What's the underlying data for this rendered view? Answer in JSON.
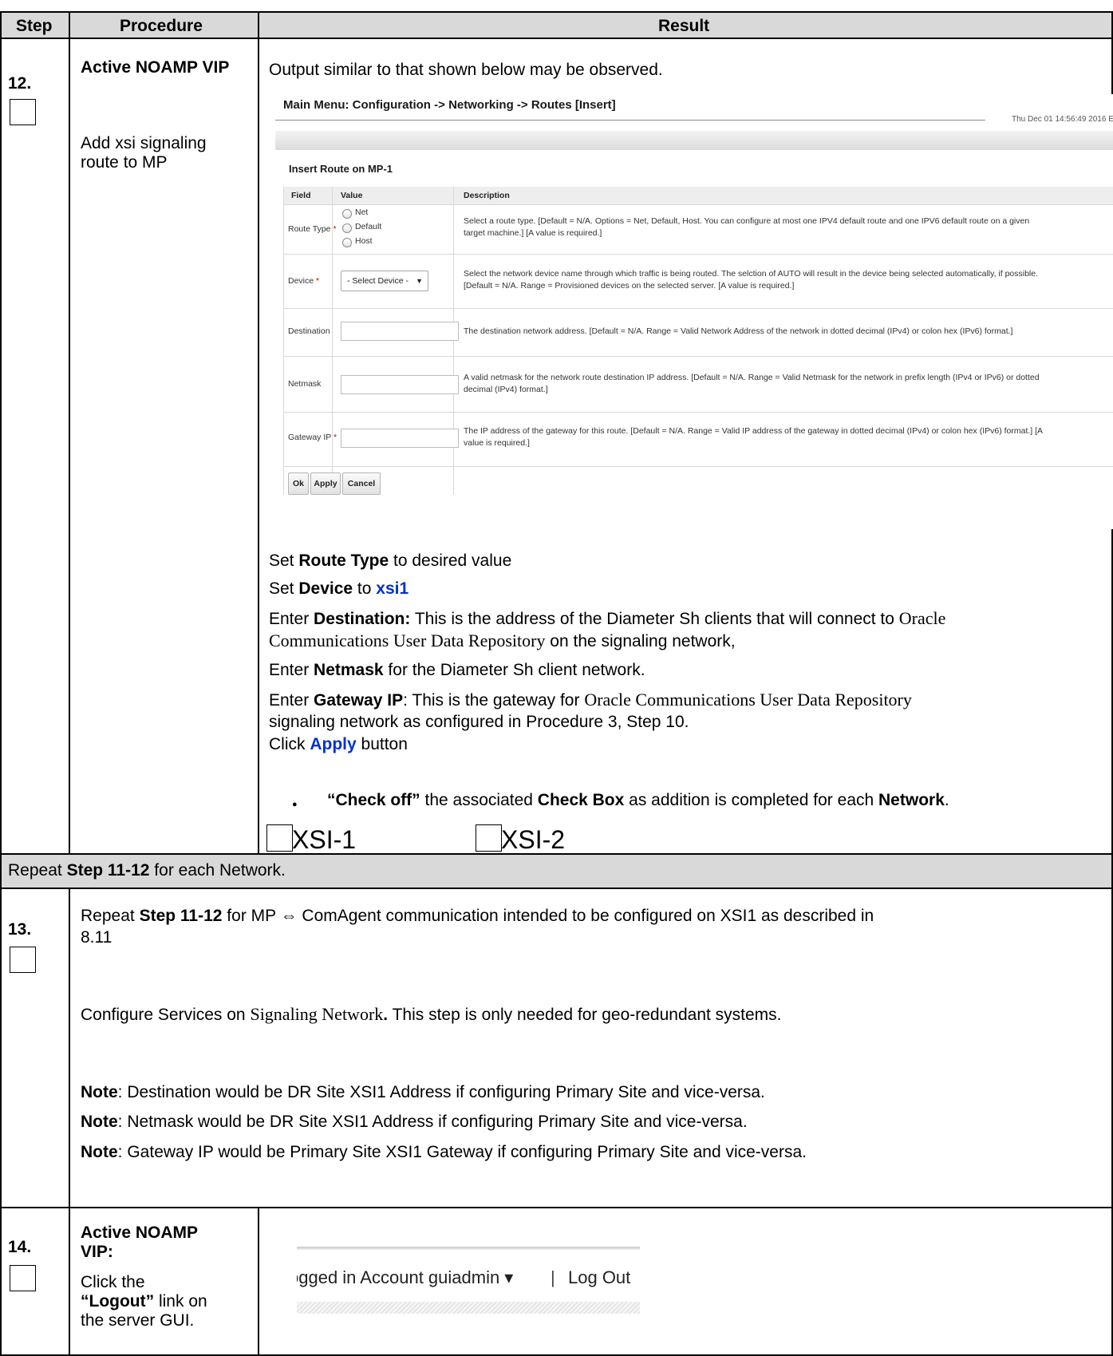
{
  "table_header": {
    "step": "Step",
    "procedure": "Procedure",
    "result": "Result"
  },
  "step12": {
    "number": "12.",
    "proc_title": "Active NOAMP VIP",
    "proc_desc": "Add xsi signaling route to MP",
    "intro": "Output similar to that shown below may be observed.",
    "screenshot": {
      "breadcrumb": "Main Menu: Configuration -> Networking -> Routes [Insert]",
      "timestamp": "Thu Dec 01 14:56:49 2016 E",
      "form_title": "Insert Route on MP-1",
      "columns": [
        "Field",
        "Value",
        "Description"
      ],
      "route_type_label": "Route Type",
      "route_type_options": [
        "Net",
        "Default",
        "Host"
      ],
      "route_type_desc_1": "Select a route type. [Default = N/A. Options = Net, Default, Host. You can configure at most one IPV4 default route and one IPV6 default route on a given",
      "route_type_desc_2": "target machine.] [A value is required.]",
      "device_label": "Device",
      "device_select": "- Select Device -",
      "device_desc_1": "Select the network device name through which traffic is being routed. The selction of AUTO will result in the device being selected automatically, if possible.",
      "device_desc_2": "[Default = N/A. Range = Provisioned devices on the selected server. [A value is required.]",
      "destination_label": "Destination",
      "destination_desc": "The destination network address. [Default = N/A. Range = Valid Network Address of the network in dotted decimal (IPv4) or colon hex (IPv6) format.]",
      "netmask_label": "Netmask",
      "netmask_desc_1": "A valid netmask for the network route destination IP address. [Default = N/A. Range = Valid Netmask for the network in prefix length (IPv4 or IPv6) or dotted",
      "netmask_desc_2": "decimal (IPv4) format.]",
      "gateway_label": "Gateway IP",
      "gateway_desc_1": "The IP address of the gateway for this route. [Default = N/A. Range = Valid IP address of the gateway in dotted decimal (IPv4) or colon hex (IPv6) format.] [A",
      "gateway_desc_2": "value is required.]",
      "required_mark": "*",
      "ok_button": "Ok",
      "apply_button": "Apply",
      "cancel_button": "Cancel"
    },
    "l1_a": "Set ",
    "l1_b": "Route Type",
    "l1_c": " to desired value",
    "l2_a": "Set ",
    "l2_b": "Device",
    "l2_c": " to ",
    "l2_d": "xsi1",
    "l3_a": "Enter ",
    "l3_b": "Destination:",
    "l3_c": " This is the address of the Diameter Sh clients that will connect to ",
    "l3_d": "Oracle",
    "l4_a": "Communications User Data Repository",
    "l4_b": " on the signaling network,",
    "l5_a": "Enter ",
    "l5_b": "Netmask",
    "l5_c": " for the Diameter Sh client network.",
    "l6_a": "Enter ",
    "l6_b": "Gateway IP",
    "l6_c": ": This is the gateway for ",
    "l6_d": "Oracle Communications User Data Repository",
    "l7": "signaling network as configured in Procedure 3, Step 10.",
    "l8_a": "Click ",
    "l8_b": "Apply",
    "l8_c": "  button",
    "bullet_a": "“Check off”",
    "bullet_b": " the associated ",
    "bullet_c": "Check Box",
    "bullet_d": " as addition is completed for each ",
    "bullet_e": "Network",
    "bullet_f": ".",
    "bullet_glyph": "●",
    "check1": "XSI-1",
    "check2": "XSI-2"
  },
  "repeat_row": {
    "a": "Repeat ",
    "b": "Step 11-12",
    "c": " for each Network."
  },
  "step13": {
    "number": "13.",
    "l1_a": "Repeat ",
    "l1_b": "Step 11-12",
    "l1_c": " for MP ⇔ ComAgent communication intended to be configured on XSI1 as described in",
    "l2": "8.11",
    "l3_a": "Configure Services on ",
    "l3_b": "Signaling Network",
    "l3_c": ".",
    "l3_d": "  This step is only needed for geo-redundant systems.",
    "note_label": "Note",
    "note1": ": Destination would be DR Site XSI1 Address if configuring Primary Site and vice-versa.",
    "note2": ": Netmask would be DR Site XSI1 Address if configuring Primary Site and vice-versa.",
    "note3": ": Gateway IP would be Primary Site XSI1 Gateway if configuring Primary Site and vice-versa."
  },
  "step14": {
    "number": "14.",
    "proc_title_1": "Active NOAMP",
    "proc_title_2": "VIP:",
    "proc_l1": "Click the",
    "proc_l2_a": "“Logout”",
    "proc_l2_b": " link on",
    "proc_l3": "the server GUI.",
    "shot_account": "ogged in Account  guiadmin ▾",
    "shot_sep": "|",
    "shot_logout": "Log Out"
  }
}
